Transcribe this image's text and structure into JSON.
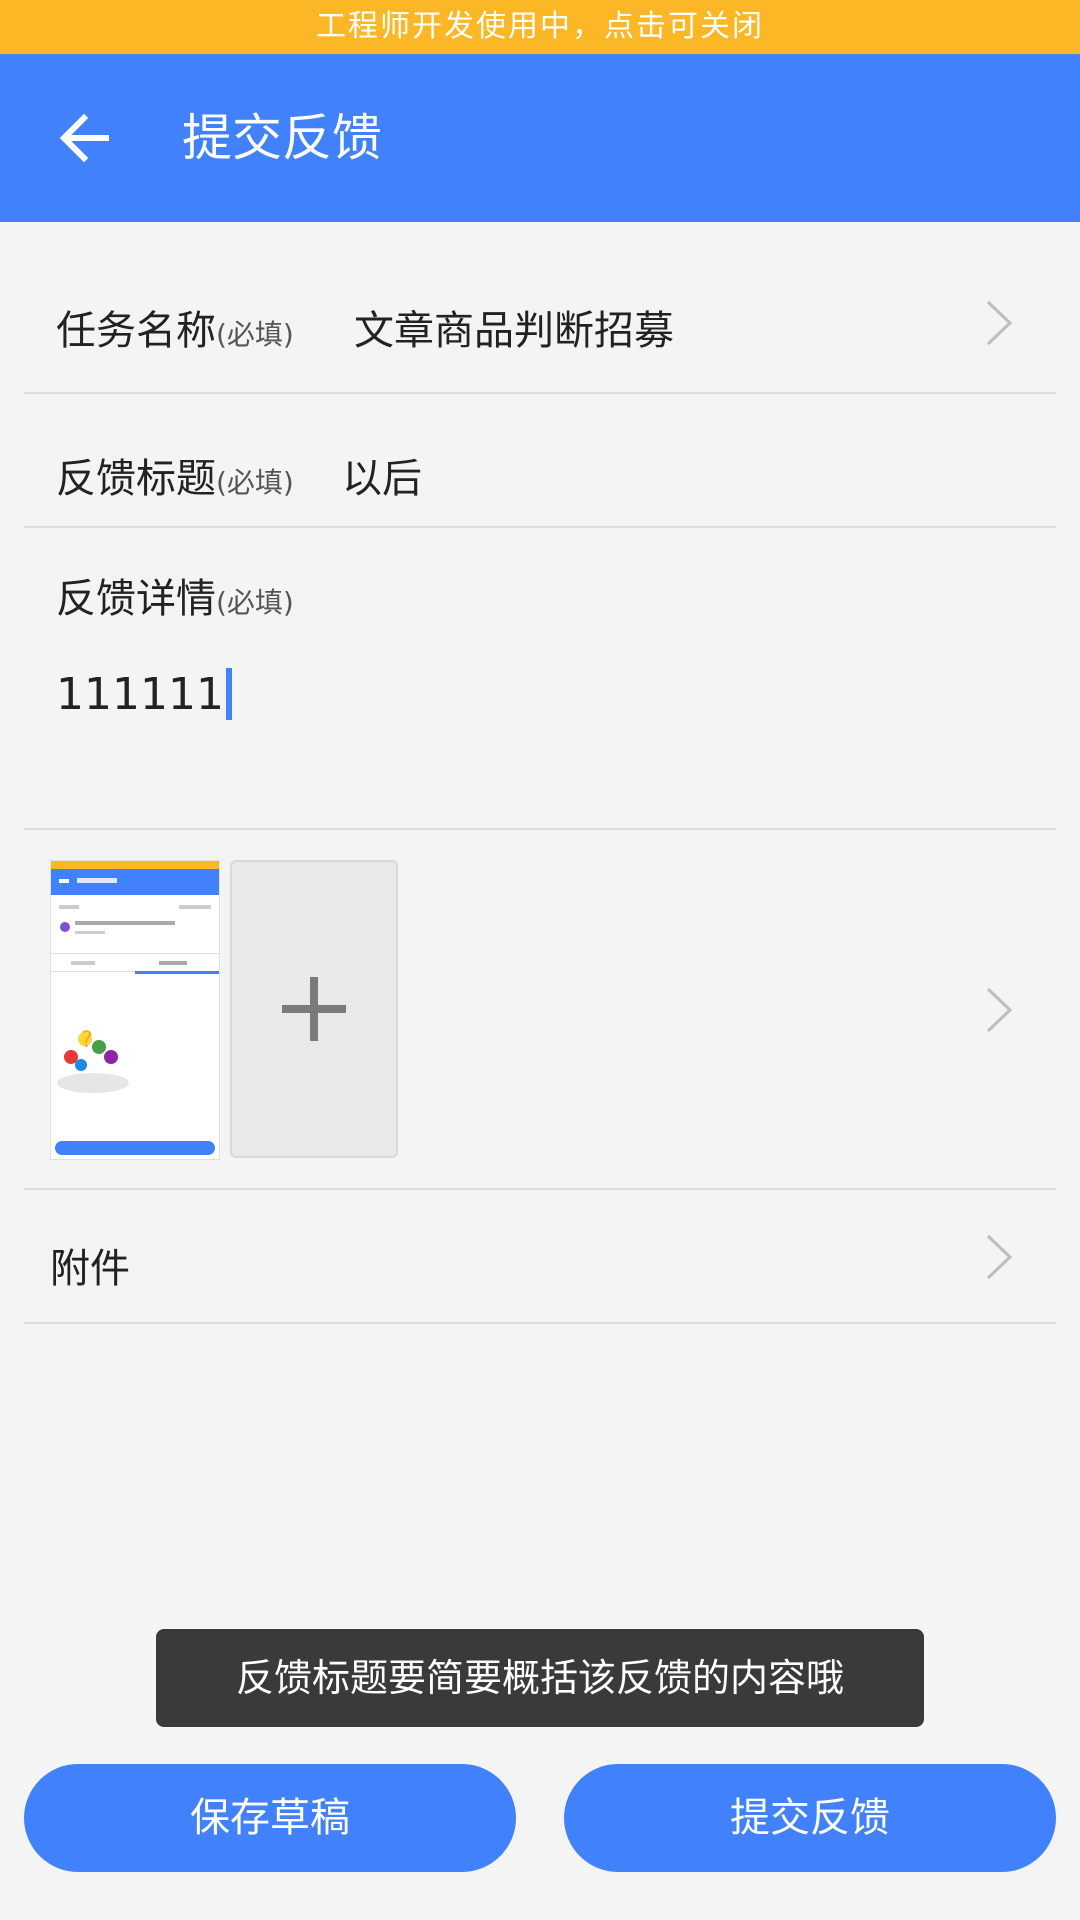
{
  "dev_banner": {
    "text": "工程师开发使用中，点击可关闭"
  },
  "app_bar": {
    "title": "提交反馈",
    "back_icon": "arrow-left-icon"
  },
  "form": {
    "task_name": {
      "label": "任务名称",
      "required": "(必填)",
      "value": "文章商品判断招募"
    },
    "feedback_title": {
      "label": "反馈标题",
      "required": "(必填)",
      "value": "以后"
    },
    "feedback_detail": {
      "label": "反馈详情",
      "required": "(必填)",
      "value": "111111"
    },
    "images": {
      "add_icon": "plus-icon",
      "thumb_icon": "screenshot-thumbnail"
    },
    "attachment": {
      "label": "附件"
    }
  },
  "toast": {
    "text": "反馈标题要简要概括该反馈的内容哦"
  },
  "buttons": {
    "save_draft": "保存草稿",
    "submit": "提交反馈"
  },
  "colors": {
    "accent": "#4182fc",
    "banner": "#fbb725",
    "toast_bg": "#3a3a3a",
    "background": "#f4f4f4"
  }
}
